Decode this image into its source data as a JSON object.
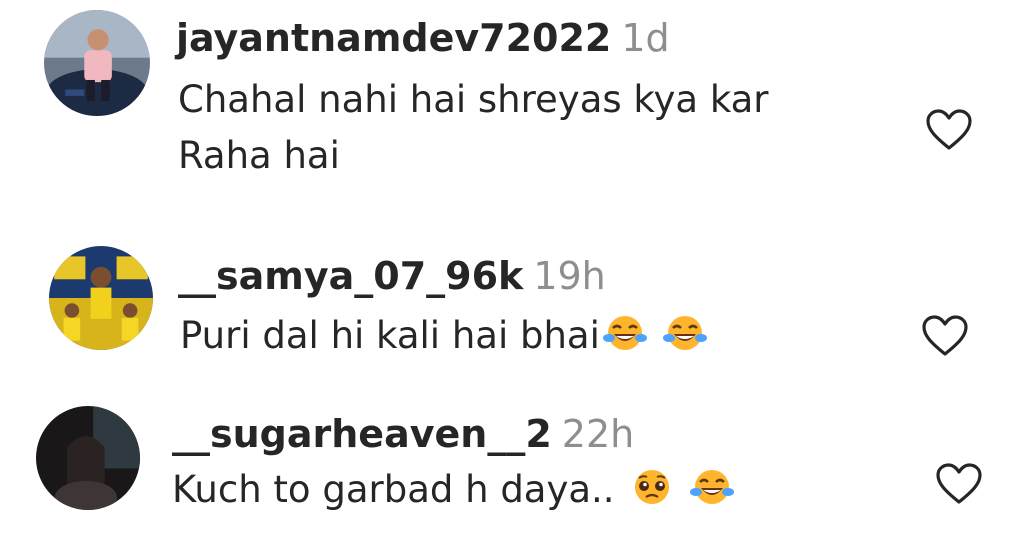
{
  "comments": [
    {
      "username": "jayantnamdev72022",
      "time": "1d",
      "text_line1": "Chahal nahi hai shreyas kya kar",
      "text_line2": "Raha hai",
      "emojis": [],
      "avatar_icon": "avatar-man-with-car-icon",
      "like_icon": "heart-outline-icon"
    },
    {
      "username": "__samya_07_96k",
      "time": "19h",
      "text_line1": "Puri dal hi kali hai bhai",
      "emojis": [
        "face-with-tears-of-joy",
        "face-with-tears-of-joy"
      ],
      "avatar_icon": "avatar-cricket-team-yellow-icon",
      "like_icon": "heart-outline-icon"
    },
    {
      "username": "__sugarheaven__2",
      "time": "22h",
      "text_line1": "Kuch to garbad h daya..",
      "emojis": [
        "pleading-face",
        "face-with-tears-of-joy"
      ],
      "avatar_icon": "avatar-person-in-dark-icon",
      "like_icon": "heart-outline-icon"
    }
  ],
  "colors": {
    "text": "#262626",
    "timestamp": "#8e8e8e",
    "heart_stroke": "#262626",
    "emoji_yellow": "#FFB42E"
  }
}
